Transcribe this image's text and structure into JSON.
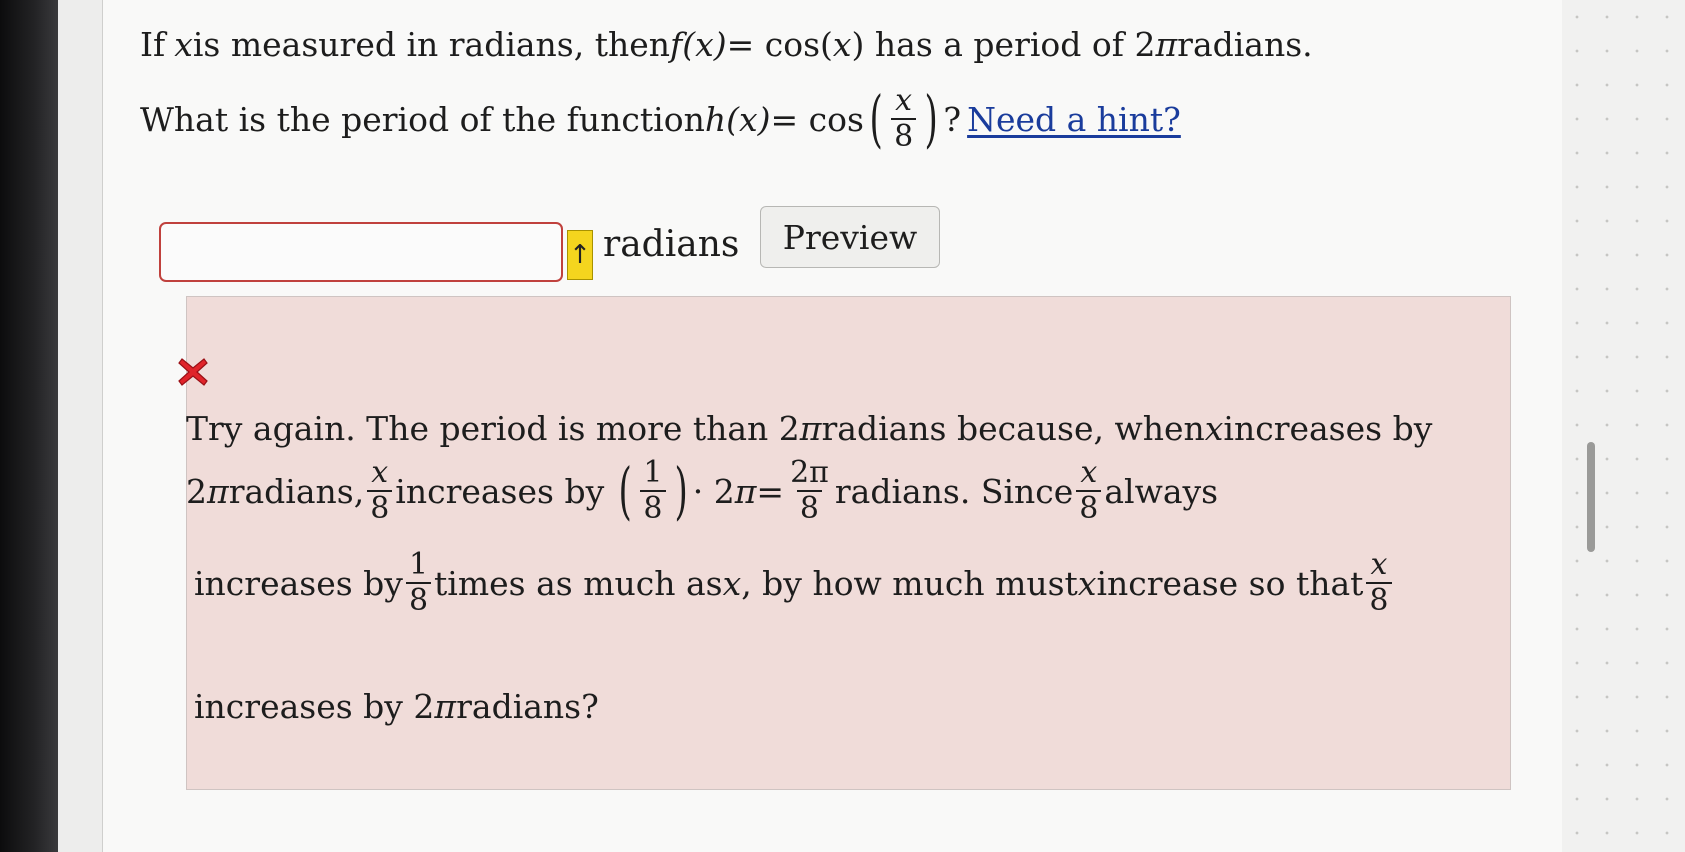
{
  "question": {
    "line1": {
      "a": "If ",
      "x": "x",
      "b": " is measured in radians, then ",
      "fx": "f(x)",
      "c": " = cos(",
      "x2": "x",
      "d": ") has a period of 2",
      "pi": "π",
      "e": " radians."
    },
    "line2": {
      "a": "What is the period of the function ",
      "hx": "h(x)",
      "b": " = cos",
      "frac_num": "x",
      "frac_den": "8",
      "c": "? ",
      "hint_link": "Need a hint?"
    }
  },
  "answer": {
    "input_value": "",
    "units": "radians",
    "preview_label": "Preview"
  },
  "feedback": {
    "icon": "red-x-icon",
    "line1": {
      "a": "Try again. The period is more than 2",
      "pi": "π",
      "b": " radians because, when ",
      "x": "x",
      "c": " increases by"
    },
    "line2": {
      "a": "2",
      "pi": "π",
      "b": " radians,",
      "f1_num": "x",
      "f1_den": "8",
      "c": " increases by",
      "f2_num": "1",
      "f2_den": "8",
      "d": "· 2",
      "pi2": "π",
      "e": " =",
      "f3_num": "2π",
      "f3_den": "8",
      "g": " radians. Since",
      "f4_num": "x",
      "f4_den": "8",
      "h": " always"
    },
    "line3": {
      "a": "increases by",
      "f1_num": "1",
      "f1_den": "8",
      "b": " times as much as ",
      "x": "x",
      "c": ", by how much must ",
      "x2": "x",
      "d": " increase so that",
      "f2_num": "x",
      "f2_den": "8"
    },
    "line4": {
      "a": "increases by 2",
      "pi": "π",
      "b": " radians?"
    }
  },
  "colors": {
    "feedback_bg": "#f0dcd9",
    "input_border_error": "#c0413d",
    "warning_tab": "#f4d51e",
    "link": "#1a3c9c"
  }
}
